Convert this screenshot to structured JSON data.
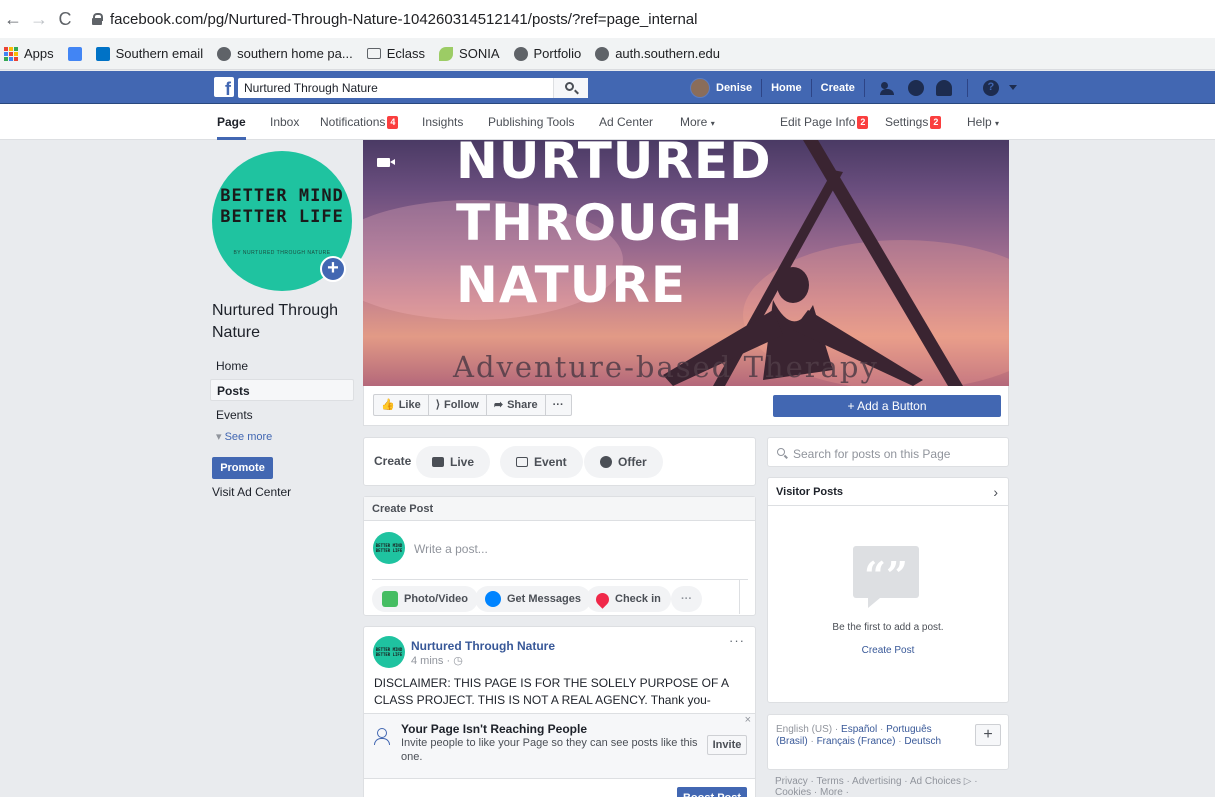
{
  "browser": {
    "url": "facebook.com/pg/Nurtured-Through-Nature-104260314512141/posts/?ref=page_internal",
    "bookmarks": [
      "Apps",
      "",
      "Southern email",
      "southern home pa...",
      "Eclass",
      "SONIA",
      "Portfolio",
      "auth.southern.edu"
    ]
  },
  "topbar": {
    "search_value": "Nurtured Through Nature",
    "user_name": "Denise",
    "home": "Home",
    "create": "Create"
  },
  "page_tabs": {
    "page": "Page",
    "inbox": "Inbox",
    "notifications": "Notifications",
    "notifications_count": "4",
    "insights": "Insights",
    "publishing_tools": "Publishing Tools",
    "ad_center": "Ad Center",
    "more": "More",
    "edit_page_info": "Edit Page Info",
    "edit_page_info_count": "2",
    "settings": "Settings",
    "settings_count": "2",
    "help": "Help"
  },
  "profile": {
    "pic_line1": "BETTER MIND",
    "pic_line2": "BETTER LIFE",
    "pic_small": "BY NURTURED THROUGH NATURE",
    "name": "Nurtured Through Nature"
  },
  "left_nav": {
    "home": "Home",
    "posts": "Posts",
    "events": "Events",
    "see_more": "See more",
    "promote": "Promote",
    "visit_ad_center": "Visit Ad Center"
  },
  "cover": {
    "line1": "NURTURED",
    "line2": "THROUGH",
    "line3": "NATURE",
    "subtitle": "Adventure-based Therapy"
  },
  "actions": {
    "like": "Like",
    "follow": "Follow",
    "share": "Share",
    "more": "···",
    "add_button": "+ Add a Button"
  },
  "create_strip": {
    "label": "Create",
    "live": "Live",
    "event": "Event",
    "offer": "Offer"
  },
  "create_post": {
    "header": "Create Post",
    "placeholder": "Write a post...",
    "photo_video": "Photo/Video",
    "get_messages": "Get Messages",
    "check_in": "Check in",
    "more": "···",
    "avatar_text": "BETTER MIND BETTER LIFE"
  },
  "post": {
    "author": "Nurtured Through Nature",
    "time": "4 mins · ",
    "text": "DISCLAIMER: THIS PAGE IS FOR THE SOLELY PURPOSE OF A CLASS PROJECT. THIS IS NOT A REAL AGENCY. Thank you-management",
    "more": "···",
    "reach_title": "Your Page Isn't Reaching People",
    "reach_text": "Invite people to like your Page so they can see posts like this one.",
    "invite": "Invite",
    "close": "×",
    "boost": "Boost Post"
  },
  "right": {
    "search_placeholder": "Search for posts on this Page",
    "visitor_title": "Visitor Posts",
    "visitor_empty": "Be the first to add a post.",
    "visitor_create": "Create Post",
    "lang_current": "English (US)",
    "lang_es": "Español",
    "lang_pt": "Português (Brasil)",
    "lang_fr": "Français (France)",
    "lang_de": "Deutsch",
    "footer": "Privacy · Terms · Advertising · Ad Choices ▷ · Cookies · More ·"
  },
  "colors": {
    "facebook_blue": "#4267b2",
    "badge_red": "#fa3e3e",
    "brand_teal": "#1fc3a0"
  }
}
